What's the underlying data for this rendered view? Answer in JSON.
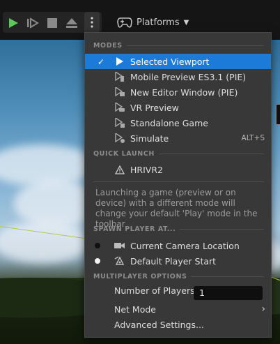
{
  "toolbar": {
    "play_icon": "play-icon",
    "step_icon": "step-icon",
    "stop_icon": "stop-icon",
    "eject_icon": "eject-icon",
    "more_icon": "vertical-dots-icon",
    "platforms_label": "Platforms",
    "accent": "#5cc95c"
  },
  "menu": {
    "sections": {
      "modes": "MODES",
      "quick_launch": "QUICK LAUNCH",
      "spawn": "SPAWN PLAYER AT...",
      "multiplayer": "MULTIPLAYER OPTIONS"
    },
    "modes": [
      {
        "label": "Selected Viewport",
        "selected": true
      },
      {
        "label": "Mobile Preview ES3.1 (PIE)"
      },
      {
        "label": "New Editor Window (PIE)"
      },
      {
        "label": "VR Preview"
      },
      {
        "label": "Standalone Game"
      },
      {
        "label": "Simulate",
        "shortcut": "ALT+S"
      }
    ],
    "quick_launch": [
      {
        "label": "HRIVR2"
      }
    ],
    "info_text": "Launching a game (preview or on device) with a different mode will change your default 'Play' mode in the toolbar",
    "spawn": [
      {
        "label": "Current Camera Location",
        "active": true
      },
      {
        "label": "Default Player Start",
        "active": false
      }
    ],
    "multiplayer": {
      "num_players_label": "Number of Players",
      "num_players_value": "1",
      "net_mode_label": "Net Mode",
      "advanced_label": "Advanced Settings..."
    },
    "selected_color": "#1c7ad8"
  }
}
